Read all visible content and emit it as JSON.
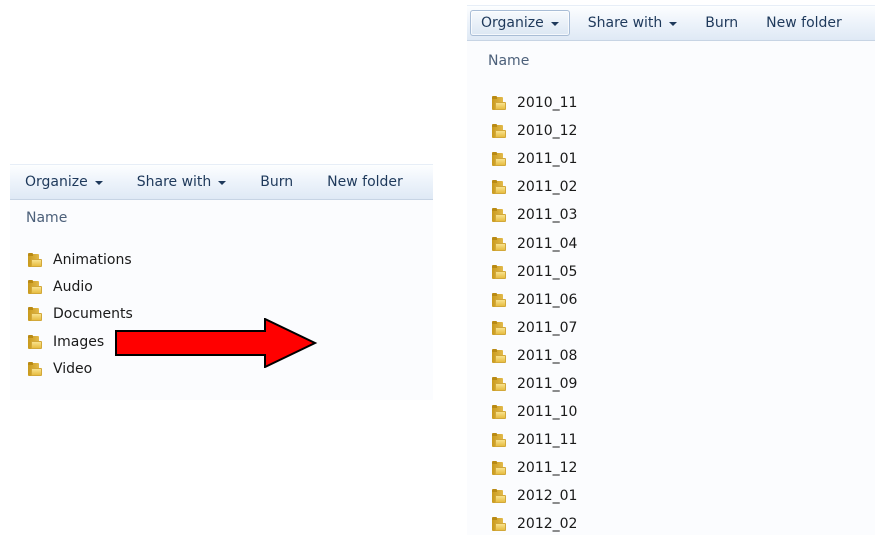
{
  "left_window": {
    "toolbar": {
      "organize": "Organize",
      "share_with": "Share with",
      "burn": "Burn",
      "new_folder": "New folder"
    },
    "column_header": "Name",
    "folders": [
      "Animations",
      "Audio",
      "Documents",
      "Images",
      "Video"
    ]
  },
  "right_window": {
    "toolbar": {
      "organize": "Organize",
      "share_with": "Share with",
      "burn": "Burn",
      "new_folder": "New folder"
    },
    "column_header": "Name",
    "folders": [
      "2010_11",
      "2010_12",
      "2011_01",
      "2011_02",
      "2011_03",
      "2011_04",
      "2011_05",
      "2011_06",
      "2011_07",
      "2011_08",
      "2011_09",
      "2011_10",
      "2011_11",
      "2011_12",
      "2012_01",
      "2012_02"
    ]
  },
  "colors": {
    "arrow_fill": "#ff0000",
    "arrow_outline": "#000000",
    "folder_yellow": "#e7bd42",
    "toolbar_text": "#1e395b"
  },
  "icons": {
    "folder": "folder-icon",
    "dropdown": "chevron-down-icon",
    "arrow": "right-arrow-icon"
  }
}
